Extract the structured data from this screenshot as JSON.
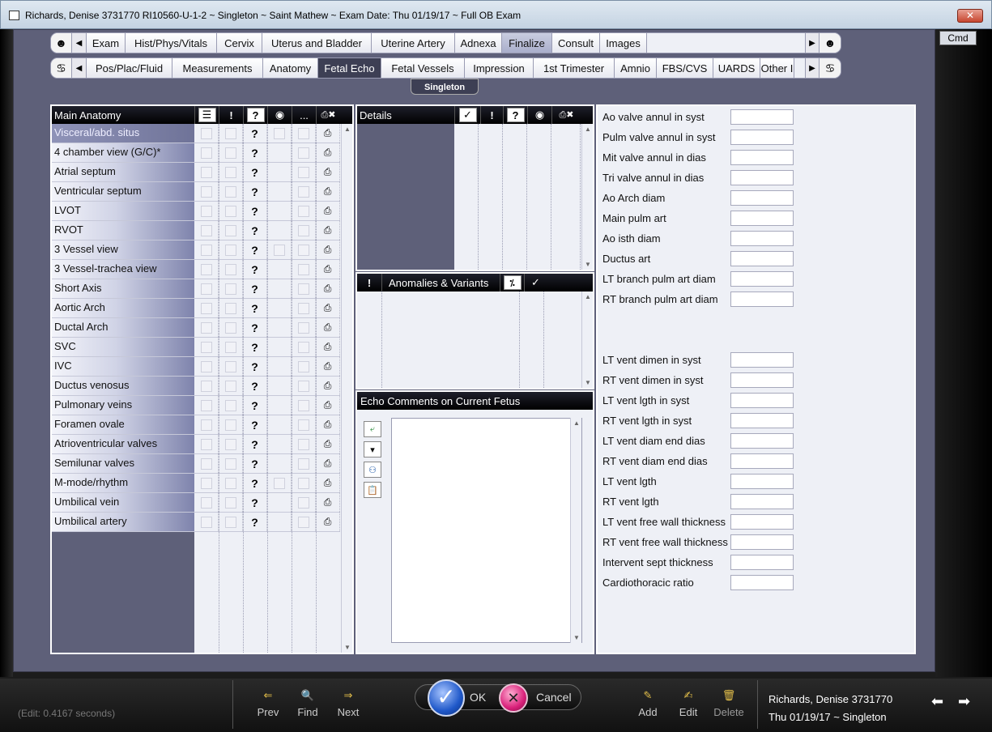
{
  "window": {
    "title": "Richards, Denise  3731770 RI10560-U-1-2 ~ Singleton ~ Saint Mathew ~ Exam Date: Thu 01/19/17 ~ Full OB Exam",
    "close_label": "✕"
  },
  "cmd_label": "Cmd",
  "tabs_row1": [
    "Exam",
    "Hist/Phys/Vitals",
    "Cervix",
    "Uterus and Bladder",
    "Uterine Artery",
    "Adnexa",
    "Finalize",
    "Consult",
    "Images"
  ],
  "tabs_row2": [
    "Pos/Plac/Fluid",
    "Measurements",
    "Anatomy",
    "Fetal Echo",
    "Fetal Vessels",
    "Impression",
    "1st Trimester",
    "Amnio",
    "FBS/CVS",
    "UARDS",
    "Other I"
  ],
  "subtab": "Singleton",
  "anatomy": {
    "title": "Main Anatomy",
    "header_icons": [
      "!",
      "?",
      "◉",
      "..."
    ],
    "rows": [
      {
        "label": "Visceral/abd. situs",
        "dot": true
      },
      {
        "label": "4 chamber view (G/C)*",
        "dot": false
      },
      {
        "label": "Atrial septum",
        "dot": false
      },
      {
        "label": "Ventricular septum",
        "dot": false
      },
      {
        "label": "LVOT",
        "dot": false
      },
      {
        "label": "RVOT",
        "dot": false
      },
      {
        "label": "3 Vessel view",
        "dot": true
      },
      {
        "label": "3 Vessel-trachea view",
        "dot": false
      },
      {
        "label": "Short Axis",
        "dot": false
      },
      {
        "label": "Aortic Arch",
        "dot": false
      },
      {
        "label": "Ductal Arch",
        "dot": false
      },
      {
        "label": "SVC",
        "dot": false
      },
      {
        "label": "IVC",
        "dot": false
      },
      {
        "label": "Ductus venosus",
        "dot": false
      },
      {
        "label": "Pulmonary veins",
        "dot": false
      },
      {
        "label": "Foramen ovale",
        "dot": false
      },
      {
        "label": "Atrioventricular valves",
        "dot": false
      },
      {
        "label": "Semilunar valves",
        "dot": false
      },
      {
        "label": "M-mode/rhythm",
        "dot": true
      },
      {
        "label": "Umbilical vein",
        "dot": false
      },
      {
        "label": "Umbilical artery",
        "dot": false
      }
    ]
  },
  "details": {
    "title": "Details"
  },
  "anomalies": {
    "title": "Anomalies & Variants",
    "bang": "!"
  },
  "comments": {
    "title": "Echo Comments on Current Fetus",
    "value": ""
  },
  "measurements_group1": [
    "Ao valve annul in syst",
    "Pulm valve annul in syst",
    "Mit valve annul in dias",
    "Tri valve annul in dias",
    "Ao Arch diam",
    "Main pulm art",
    "Ao isth diam",
    "Ductus art",
    "LT branch pulm art diam",
    "RT branch pulm art diam"
  ],
  "measurements_group2": [
    "LT vent dimen in syst",
    "RT vent dimen in syst",
    "LT vent lgth in syst",
    "RT vent lgth in syst",
    "LT vent diam end dias",
    "RT vent diam end dias",
    "LT vent lgth",
    "RT vent lgth",
    "LT vent free wall thickness",
    "RT vent free wall thickness",
    "Intervent sept thickness",
    "Cardiothoracic ratio"
  ],
  "bottom": {
    "edit_time": "(Edit: 0.4167 seconds)",
    "prev": "Prev",
    "find": "Find",
    "next": "Next",
    "ok": "OK",
    "cancel": "Cancel",
    "add": "Add",
    "edit": "Edit",
    "delete": "Delete",
    "patient_line1": "Richards, Denise  3731770",
    "patient_line2": "Thu 01/19/17 ~ Singleton"
  }
}
